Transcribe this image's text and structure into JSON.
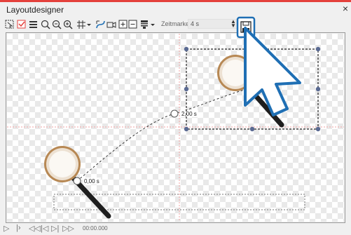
{
  "window": {
    "title": "Layoutdesigner",
    "close_label": "×"
  },
  "toolbar": {
    "timemark_label": "Zeitmarke:",
    "timemark_value": "4 s"
  },
  "canvas": {
    "start_marker_label": "0,00 s",
    "mid_marker_label": "2,00 s"
  },
  "player": {
    "timecode": "00:00.000"
  },
  "colors": {
    "accent": "#e4413c",
    "highlight": "#1f6fb4",
    "handle": "#3d4f7c"
  }
}
